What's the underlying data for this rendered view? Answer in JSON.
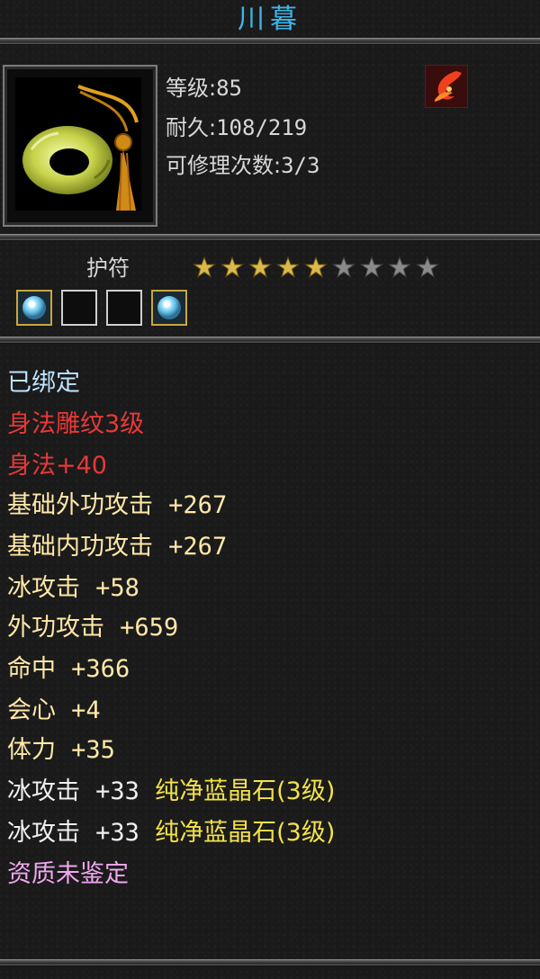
{
  "item": {
    "name": "川暮",
    "level_label": "等级:",
    "level_value": "85",
    "durability_label": "耐久:",
    "durability_value": "108/219",
    "repair_label": "可修理次数:",
    "repair_value": "3/3",
    "category": "护符",
    "icon": "jade-ring-pendant-icon",
    "type_icon": "flame-swirl-icon"
  },
  "stars": {
    "filled": 5,
    "total": 9,
    "filled_color": "#d9b94a",
    "empty_color": "#8a8a8a"
  },
  "sockets": [
    {
      "state": "filled",
      "icon": "blue-crystal-gem-icon"
    },
    {
      "state": "empty"
    },
    {
      "state": "empty"
    },
    {
      "state": "filled",
      "icon": "blue-crystal-gem-icon"
    }
  ],
  "attributes": {
    "bound": "已绑定",
    "engrave": "身法雕纹3级",
    "agility": "身法+40",
    "base_ext_atk_label": "基础外功攻击",
    "base_ext_atk_value": "+267",
    "base_int_atk_label": "基础内功攻击",
    "base_int_atk_value": "+267",
    "ice_atk_label": "冰攻击",
    "ice_atk_value": "+58",
    "ext_atk_label": "外功攻击",
    "ext_atk_value": "+659",
    "hit_label": "命中",
    "hit_value": "+366",
    "crit_label": "会心",
    "crit_value": "+4",
    "stamina_label": "体力",
    "stamina_value": "+35",
    "gem1_label": "冰攻击",
    "gem1_value": "+33",
    "gem1_name": "纯净蓝晶石(3级)",
    "gem2_label": "冰攻击",
    "gem2_value": "+33",
    "gem2_name": "纯净蓝晶石(3级)",
    "aptitude": "资质未鉴定"
  },
  "colors": {
    "title": "#3fb5e8",
    "bound": "#bfe4ff",
    "red": "#e83838",
    "tan": "#ffe8a8",
    "gem": "#f2e24a",
    "pink": "#f0a8f0"
  }
}
